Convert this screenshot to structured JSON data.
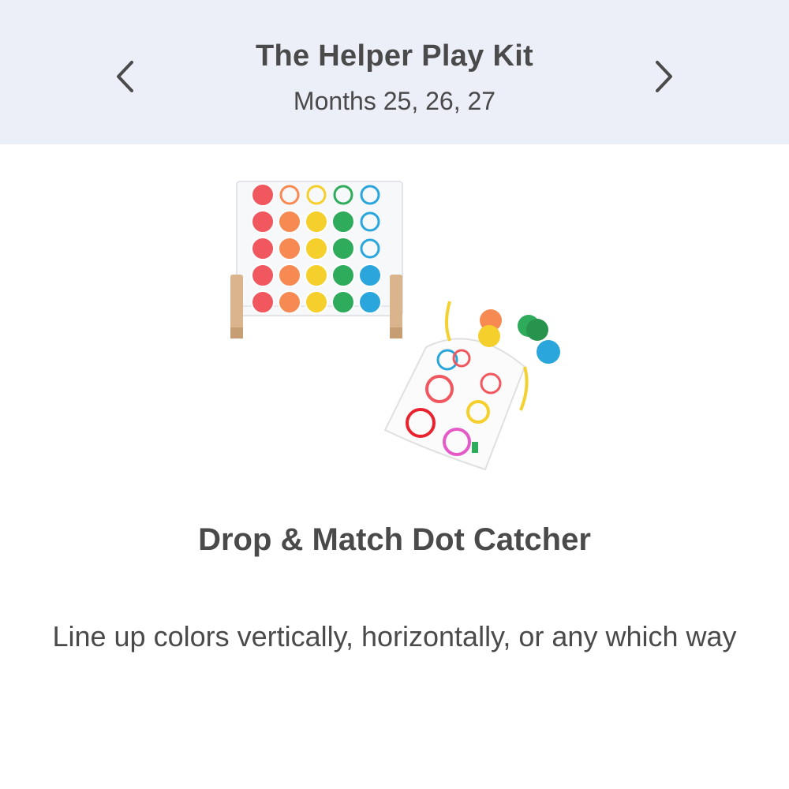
{
  "header": {
    "title": "The Helper Play Kit",
    "subtitle": "Months 25, 26, 27",
    "prev_icon": "chevron-left-icon",
    "next_icon": "chevron-right-icon",
    "background_color": "#eceef8"
  },
  "product": {
    "image_icon": "drop-and-match-dot-catcher-illustration",
    "name": "Drop & Match Dot Catcher",
    "description": "Line up colors vertically, horizontally, or any which way"
  },
  "palette": {
    "red": "#f0575f",
    "orange": "#f78a52",
    "yellow": "#f5cf2b",
    "green": "#2fab5c",
    "blue": "#2aa6dd",
    "wood": "#d9b48c",
    "text": "#4a4a4a"
  }
}
